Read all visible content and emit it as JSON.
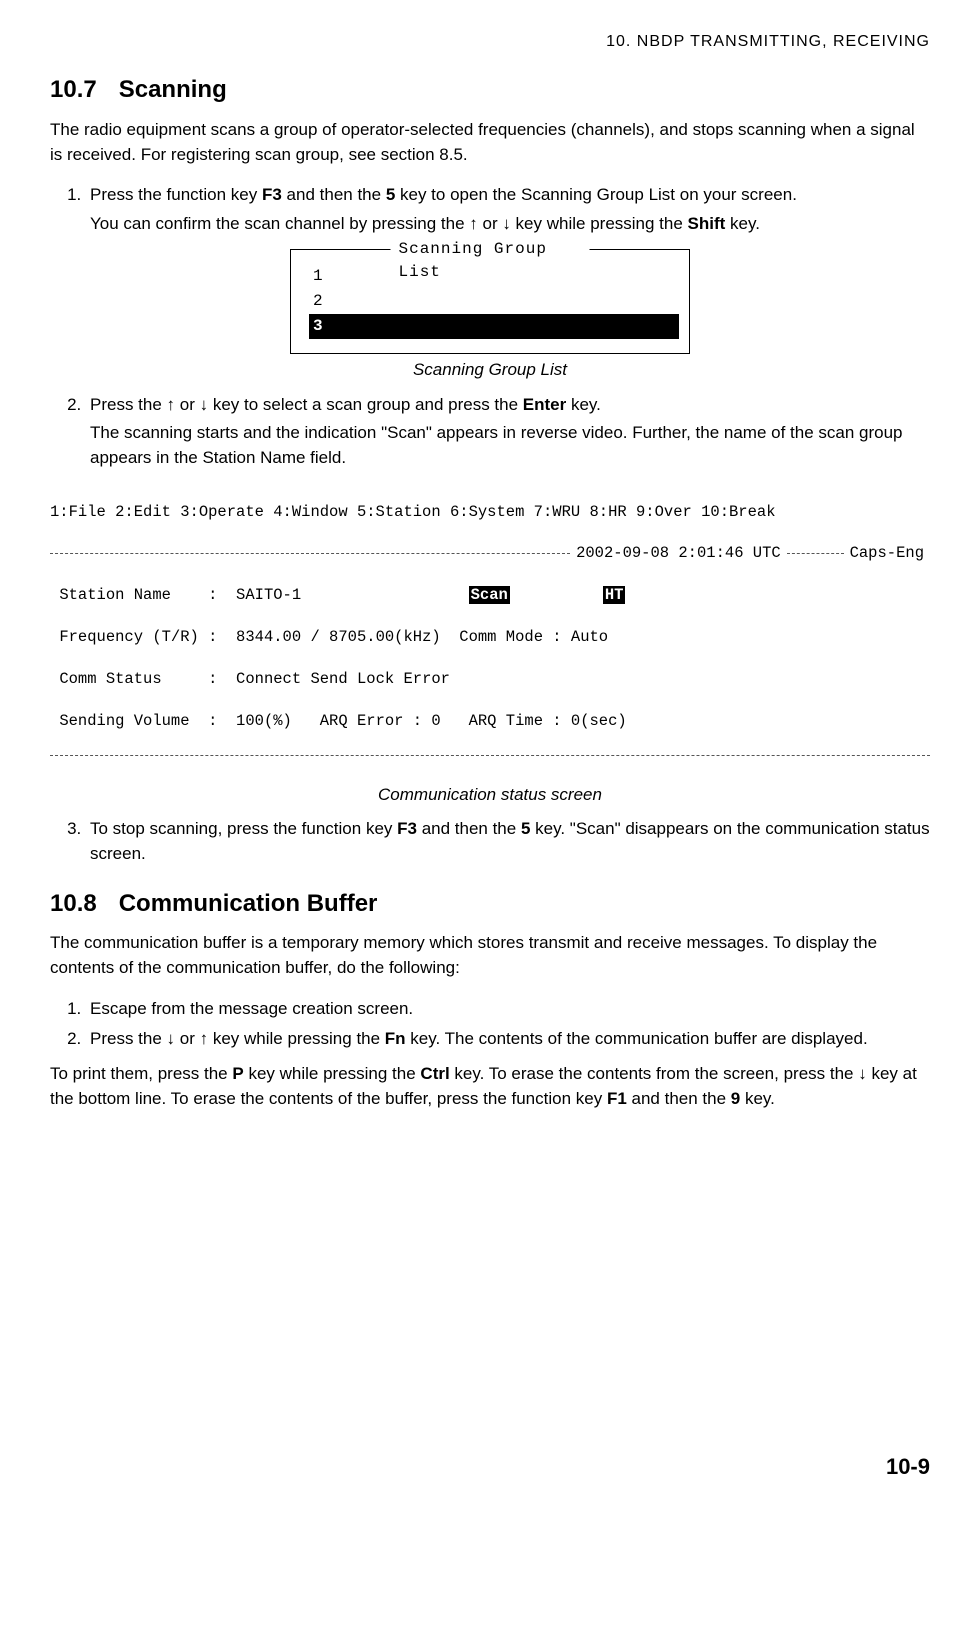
{
  "header": {
    "chapter": "10.  NBDP  TRANSMITTING,  RECEIVING"
  },
  "section107": {
    "number": "10.7",
    "title": "Scanning",
    "intro": "The radio equipment scans a group of operator-selected frequencies (channels), and stops scanning when a signal is received. For registering scan group, see section 8.5.",
    "step1a": "Press the function key ",
    "step1b": " and then the ",
    "step1c": " key to open the Scanning Group List on your screen.",
    "step1sub_a": "You can confirm the scan channel by pressing the ↑ or ↓ key while pressing the ",
    "step1sub_b": " key.",
    "key_f3": "F3",
    "key_5": "5",
    "key_shift": "Shift",
    "key_enter": "Enter",
    "sgl_title": "Scanning Group List",
    "sgl_items": {
      "i1": "1",
      "i2": "2",
      "i3": "3"
    },
    "sgl_caption": "Scanning Group List",
    "step2a": "Press the ↑ or ↓ key to select a scan group and press the ",
    "step2b": " key.",
    "step2sub": "The scanning starts and the indication \"Scan\" appears in reverse video. Further, the name of the scan group appears in the Station Name field.",
    "comm": {
      "menubar": "1:File 2:Edit 3:Operate 4:Window 5:Station 6:System 7:WRU 8:HR 9:Over 10:Break",
      "datetime": "2002-09-08 2:01:46 UTC",
      "capseng": "Caps-Eng",
      "l1_label": "Station Name    :  SAITO-1",
      "scan": "Scan",
      "ht": "HT",
      "l2": "Frequency (T/R) :  8344.00 / 8705.00(kHz)  Comm Mode : Auto",
      "l3": "Comm Status     :  Connect Send Lock Error",
      "l4": "Sending Volume  :  100(%)   ARQ Error : 0   ARQ Time : 0(sec)"
    },
    "comm_caption": "Communication status screen",
    "step3a": "To stop scanning, press the function key ",
    "step3b": " and then the ",
    "step3c": " key. \"Scan\" disappears on the communication status screen."
  },
  "section108": {
    "number": "10.8",
    "title": "Communication Buffer",
    "intro": "The communication buffer is a temporary memory which stores transmit and receive messages. To display the contents of the communication buffer, do the following:",
    "step1": "Escape from the message creation screen.",
    "step2a": "Press the ↓ or ↑ key while pressing the ",
    "step2b": " key. The contents of the communication buffer are displayed.",
    "key_fn": "Fn",
    "post_a": "To print them, press the ",
    "key_p": "P",
    "post_b": " key while pressing the ",
    "key_ctrl": "Ctrl",
    "post_c": " key. To erase the contents from the screen, press the ↓ key at the bottom line. To erase the contents of the buffer, press the function key ",
    "key_f1": "F1",
    "post_d": " and then the ",
    "key_9": "9",
    "post_e": " key."
  },
  "page_number": "10-9"
}
